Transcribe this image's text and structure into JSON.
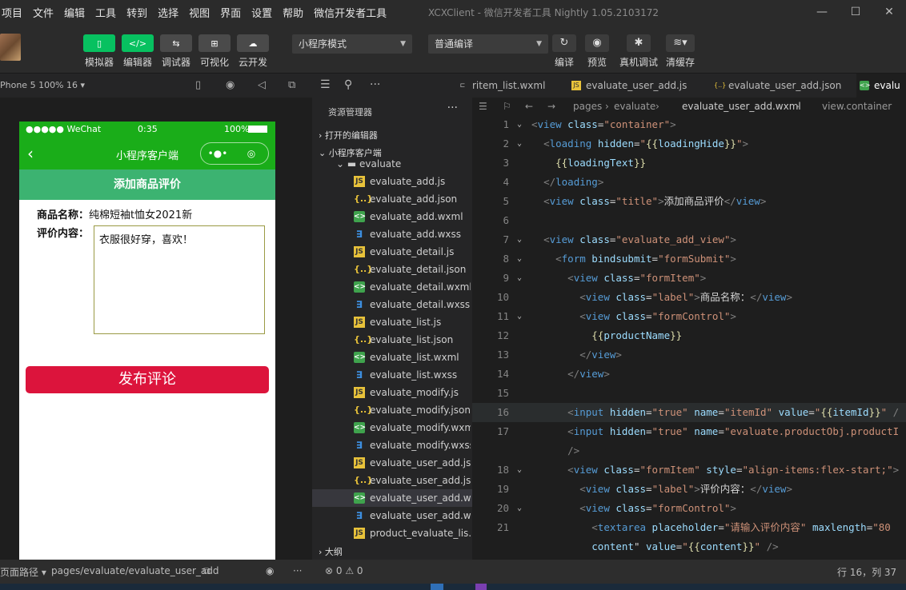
{
  "menu": {
    "items": [
      "项目",
      "文件",
      "编辑",
      "工具",
      "转到",
      "选择",
      "视图",
      "界面",
      "设置",
      "帮助",
      "微信开发者工具"
    ],
    "title": "XCXClient - 微信开发者工具 Nightly 1.05.2103172"
  },
  "toolbar": {
    "simulator": "模拟器",
    "editor": "编辑器",
    "debugger": "调试器",
    "visual": "可视化",
    "cloud": "云开发",
    "mode": "小程序模式",
    "compile_mode": "普通编译",
    "compile": "编译",
    "preview": "预览",
    "real_debug": "真机调试",
    "clear_cache": "清缓存"
  },
  "simulator": {
    "device": "Phone 5 100% 16 ▾",
    "status": {
      "carrier": "●●●●● WeChat",
      "time": "0:35",
      "battery": "100%"
    },
    "nav_title": "小程序客户端",
    "page_title": "添加商品评价",
    "product_label": "商品名称：",
    "product_value": "纯棉短袖t恤女2021新",
    "comment_label": "评价内容：",
    "comment_value": "衣服很好穿，喜欢！",
    "submit": "发布评论"
  },
  "explorer": {
    "header": "资源管理器",
    "open_editors": "打开的编辑器",
    "project": "小程序客户端",
    "folder": "evaluate",
    "files": [
      {
        "name": "evaluate_add.js",
        "type": "js"
      },
      {
        "name": "evaluate_add.json",
        "type": "json"
      },
      {
        "name": "evaluate_add.wxml",
        "type": "wxml"
      },
      {
        "name": "evaluate_add.wxss",
        "type": "wxss"
      },
      {
        "name": "evaluate_detail.js",
        "type": "js"
      },
      {
        "name": "evaluate_detail.json",
        "type": "json"
      },
      {
        "name": "evaluate_detail.wxml",
        "type": "wxml"
      },
      {
        "name": "evaluate_detail.wxss",
        "type": "wxss"
      },
      {
        "name": "evaluate_list.js",
        "type": "js"
      },
      {
        "name": "evaluate_list.json",
        "type": "json"
      },
      {
        "name": "evaluate_list.wxml",
        "type": "wxml"
      },
      {
        "name": "evaluate_list.wxss",
        "type": "wxss"
      },
      {
        "name": "evaluate_modify.js",
        "type": "js"
      },
      {
        "name": "evaluate_modify.json",
        "type": "json"
      },
      {
        "name": "evaluate_modify.wxml",
        "type": "wxml"
      },
      {
        "name": "evaluate_modify.wxss",
        "type": "wxss"
      },
      {
        "name": "evaluate_user_add.js",
        "type": "js"
      },
      {
        "name": "evaluate_user_add.js...",
        "type": "json"
      },
      {
        "name": "evaluate_user_add.w...",
        "type": "wxml",
        "selected": true
      },
      {
        "name": "evaluate_user_add.w...",
        "type": "wxss"
      },
      {
        "name": "product_evaluate_lis...",
        "type": "js"
      }
    ],
    "outline": "大纲"
  },
  "tabs": [
    {
      "label": "ritem_list.wxml",
      "type": "wxml"
    },
    {
      "label": "evaluate_user_add.js",
      "type": "js"
    },
    {
      "label": "evaluate_user_add.json",
      "type": "json"
    },
    {
      "label": "evalu",
      "type": "wxml",
      "active": true
    }
  ],
  "breadcrumb": [
    "pages",
    "evaluate",
    "evaluate_user_add.wxml",
    "view.container"
  ],
  "statusbar": {
    "page_path_label": "页面路径 ▾",
    "page_path": "pages/evaluate/evaluate_user_add",
    "problems": "⊗ 0 ⚠ 0",
    "cursor": "行 16，列 37"
  },
  "colors": {
    "wechat_green": "#1aad19",
    "title_green": "#3cb371",
    "submit_red": "#dc143c",
    "tool_green": "#07c160"
  }
}
